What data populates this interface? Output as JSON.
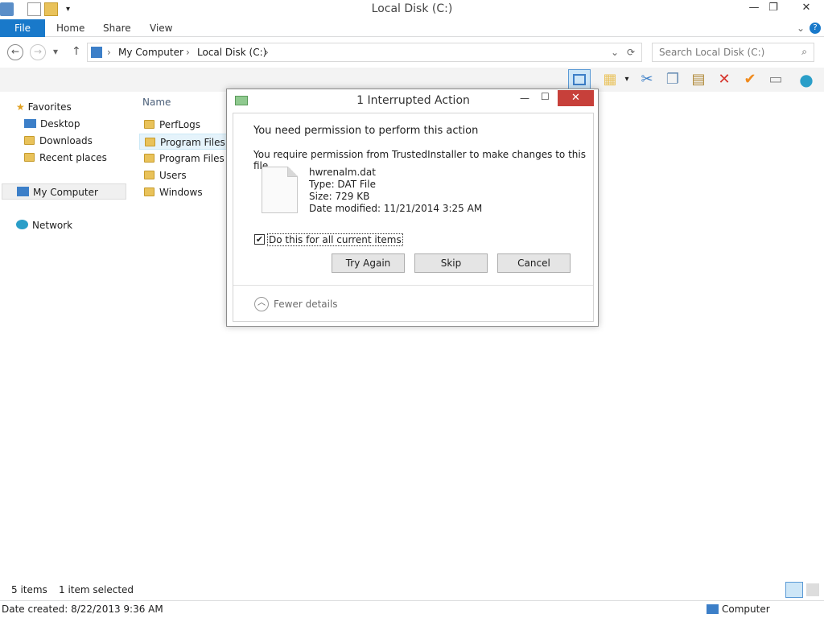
{
  "window": {
    "title": "Local Disk (C:)",
    "minimize": "—",
    "maximize": "❐",
    "close": "✕",
    "help": "?"
  },
  "ribbon": {
    "file": "File",
    "tabs": [
      "Home",
      "Share",
      "View"
    ],
    "expand": "⌄"
  },
  "address": {
    "back": "←",
    "forward": "→",
    "recent": "▾",
    "up": "↑",
    "crumbs": [
      "My Computer",
      "Local Disk (C:)"
    ],
    "sep": "›",
    "dropdown": "⌄",
    "refresh": "⟳",
    "search_placeholder": "Search Local Disk (C:)",
    "search_icon": "⌕"
  },
  "navpane": {
    "favorites": "Favorites",
    "desktop": "Desktop",
    "downloads": "Downloads",
    "recent": "Recent places",
    "computer": "My Computer",
    "network": "Network"
  },
  "files": {
    "column_name": "Name",
    "items": [
      "PerfLogs",
      "Program Files",
      "Program Files (x86)",
      "Users",
      "Windows"
    ]
  },
  "status": {
    "count": "5 items",
    "selected": "1 item selected"
  },
  "details": {
    "date_created": "Date created: 8/22/2013 9:36 AM",
    "computer": "Computer"
  },
  "dialog": {
    "title": "1 Interrupted Action",
    "minimize": "—",
    "maximize": "☐",
    "close": "✕",
    "heading": "You need permission to perform this action",
    "message": "You require permission from TrustedInstaller to make changes to this file",
    "file": {
      "name": "hwrenalm.dat",
      "type": "Type: DAT File",
      "size": "Size: 729 KB",
      "modified": "Date modified: 11/21/2014 3:25 AM"
    },
    "checkbox": {
      "label": "Do this for all current items",
      "checked": true,
      "mark": "✔"
    },
    "buttons": {
      "try_again": "Try Again",
      "skip": "Skip",
      "cancel": "Cancel"
    },
    "fewer": {
      "label": "Fewer details",
      "icon": "︿"
    }
  },
  "icons": {
    "toolbar": [
      "layout-icon",
      "checklist-folder-icon",
      "dropdown-icon",
      "cut-icon",
      "copy-icon",
      "paste-icon",
      "delete-icon",
      "checkmark-icon",
      "rename-icon",
      "globe-icon"
    ]
  }
}
